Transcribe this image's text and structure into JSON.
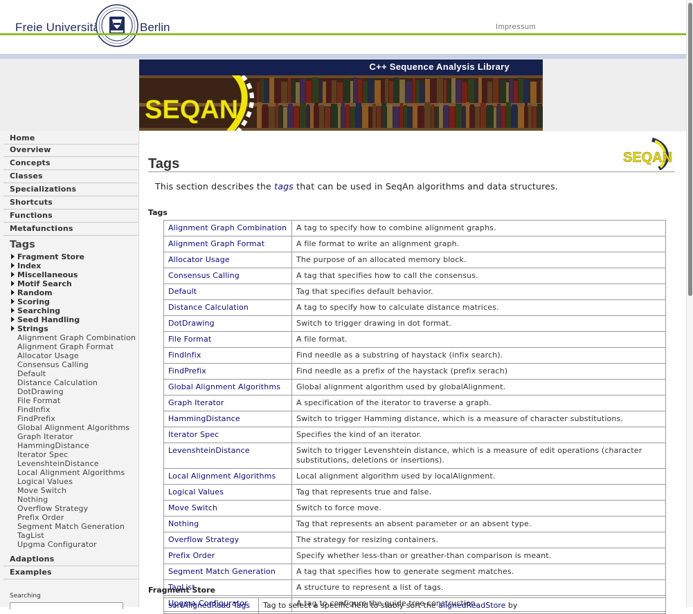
{
  "header": {
    "uni_left": "Freie Universität",
    "uni_right": "Berlin",
    "impressum": "Impressum",
    "seal_text": "VERITAS IUSTITIA LIBERTAS",
    "seal_bottom": "FREIE UNIVERSITÄT BERLIN",
    "accent_green": "#8fbe2a"
  },
  "banner": {
    "title": "C++ Sequence Analysis Library",
    "logo_text": "SEQAN"
  },
  "sidebar": {
    "nav_top": [
      "Home",
      "Overview",
      "Concepts",
      "Classes",
      "Specializations",
      "Shortcuts",
      "Functions",
      "Metafunctions"
    ],
    "tags_heading": "Tags",
    "tag_groups": [
      "Fragment Store",
      "Index",
      "Miscellaneous",
      "Motif Search",
      "Random",
      "Scoring",
      "Searching",
      "Seed Handling",
      "Strings"
    ],
    "tag_items": [
      "Alignment Graph Combination",
      "Alignment Graph Format",
      "Allocator Usage",
      "Consensus Calling",
      "Default",
      "Distance Calculation",
      "DotDrawing",
      "File Format",
      "FindInfix",
      "FindPrefix",
      "Global Alignment Algorithms",
      "Graph Iterator",
      "HammingDistance",
      "Iterator Spec",
      "LevenshteinDistance",
      "Local Alignment Algorithms",
      "Logical Values",
      "Move Switch",
      "Nothing",
      "Overflow Strategy",
      "Prefix Order",
      "Segment Match Generation",
      "TagList",
      "Upgma Configurator"
    ],
    "nav_bottom": [
      "Adaptions",
      "Examples"
    ],
    "search_label": "Searching"
  },
  "main": {
    "title": "Tags",
    "logo_text": "SEQAN",
    "intro_before": "This section describes the ",
    "intro_link": "tags",
    "intro_after": " that can be used in SeqAn algorithms and data structures.",
    "section_tags": "Tags",
    "tags": [
      {
        "name": "Alignment Graph Combination",
        "desc": "A tag to specify how to combine alignment graphs."
      },
      {
        "name": "Alignment Graph Format",
        "desc": "A file format to write an alignment graph."
      },
      {
        "name": "Allocator Usage",
        "desc": "The purpose of an allocated memory block."
      },
      {
        "name": "Consensus Calling",
        "desc": "A tag that specifies how to call the consensus."
      },
      {
        "name": "Default",
        "desc": "Tag that specifies default behavior."
      },
      {
        "name": "Distance Calculation",
        "desc": "A tag to specify how to calculate distance matrices."
      },
      {
        "name": "DotDrawing",
        "desc": "Switch to trigger drawing in dot format."
      },
      {
        "name": "File Format",
        "desc": "A file format."
      },
      {
        "name": "FindInfix",
        "desc": "Find needle as a substring of haystack (infix search)."
      },
      {
        "name": "FindPrefix",
        "desc": "Find needle as a prefix of the haystack (prefix serach)"
      },
      {
        "name": "Global Alignment Algorithms",
        "desc": "Global alignment algorithm used by globalAlignment."
      },
      {
        "name": "Graph Iterator",
        "desc": "A specification of the iterator to traverse a graph."
      },
      {
        "name": "HammingDistance",
        "desc": "Switch to trigger Hamming distance, which is a measure of character substitutions."
      },
      {
        "name": "Iterator Spec",
        "desc": "Specifies the kind of an iterator."
      },
      {
        "name": "LevenshteinDistance",
        "desc": "Switch to trigger Levenshtein distance, which is a measure of edit operations (character substitutions, deletions or insertions)."
      },
      {
        "name": "Local Alignment Algorithms",
        "desc": "Local alignment algorithm used by localAlignment."
      },
      {
        "name": "Logical Values",
        "desc": "Tag that represents true and false."
      },
      {
        "name": "Move Switch",
        "desc": "Switch to force move."
      },
      {
        "name": "Nothing",
        "desc": "Tag that represents an absent parameter or an absent type."
      },
      {
        "name": "Overflow Strategy",
        "desc": "The strategy for resizing containers."
      },
      {
        "name": "Prefix Order",
        "desc": "Specify whether less-than or greather-than comparison is meant."
      },
      {
        "name": "Segment Match Generation",
        "desc": "A tag that specifies how to generate segment matches."
      },
      {
        "name": "TagList",
        "desc": "A structure to represent a list of tags."
      },
      {
        "name": "Upgma Configurator",
        "desc": "A tag to configure the guide tree construction."
      }
    ],
    "section_fragment": "Fragment Store",
    "fragment_row": {
      "name": "sortAlignedRead Tags",
      "desc_before": "Tag to select a specific field to stably sort the ",
      "desc_link": "alignedReadStore",
      "desc_after": " by"
    }
  }
}
